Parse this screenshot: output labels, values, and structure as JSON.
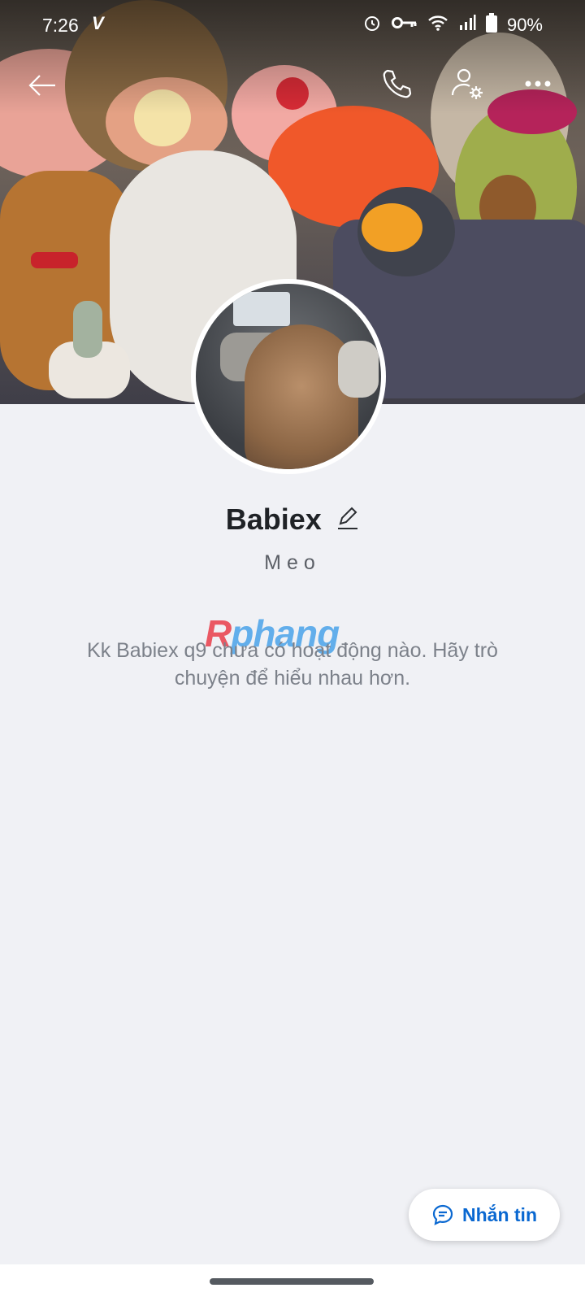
{
  "status_bar": {
    "time": "7:26",
    "battery": "90%"
  },
  "profile": {
    "name": "Babiex",
    "subtitle": "Meo",
    "empty_message": "Kk Babiex q9 chưa có hoạt động nào. Hãy trò chuyện để hiểu nhau hơn."
  },
  "watermark": {
    "first_letter": "R",
    "rest": "phang"
  },
  "message_button": {
    "label": "Nhắn tin"
  },
  "icons": [
    "back-arrow-icon",
    "phone-icon",
    "user-settings-icon",
    "more-icon",
    "edit-icon",
    "chat-icon"
  ]
}
